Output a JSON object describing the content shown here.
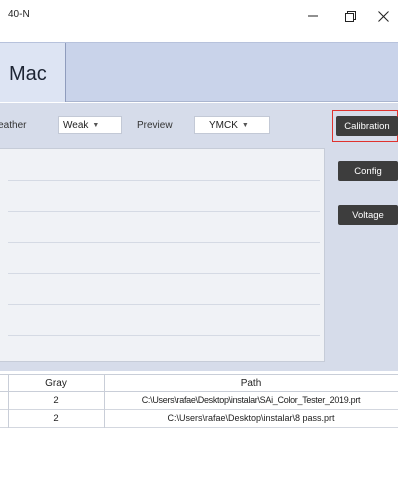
{
  "window": {
    "title": "40-N",
    "controls": {
      "minimize": "minimize-icon",
      "maximize": "maximize-icon",
      "close": "close-icon"
    }
  },
  "header": {
    "tab_label": "Mac"
  },
  "toolbar": {
    "feather_label": "Feather",
    "feather_value": "Weak",
    "preview_label": "Preview",
    "preview_value": "YMCK"
  },
  "side_buttons": {
    "calibration": "Calibration",
    "config": "Config",
    "voltage": "Voltage"
  },
  "table": {
    "columns": [
      "Gray",
      "Path"
    ],
    "rows": [
      {
        "gray": "2",
        "path": "C:\\Users\\rafae\\Desktop\\instalar\\SAi_Color_Tester_2019.prt"
      },
      {
        "gray": "2",
        "path": "C:\\Users\\rafae\\Desktop\\instalar\\8 pass.prt"
      }
    ]
  },
  "colors": {
    "header_band": "#c9d3ea",
    "panel_bg": "#d6dcea",
    "button_dark": "#3d3d3d",
    "highlight_red": "#e0322e"
  }
}
